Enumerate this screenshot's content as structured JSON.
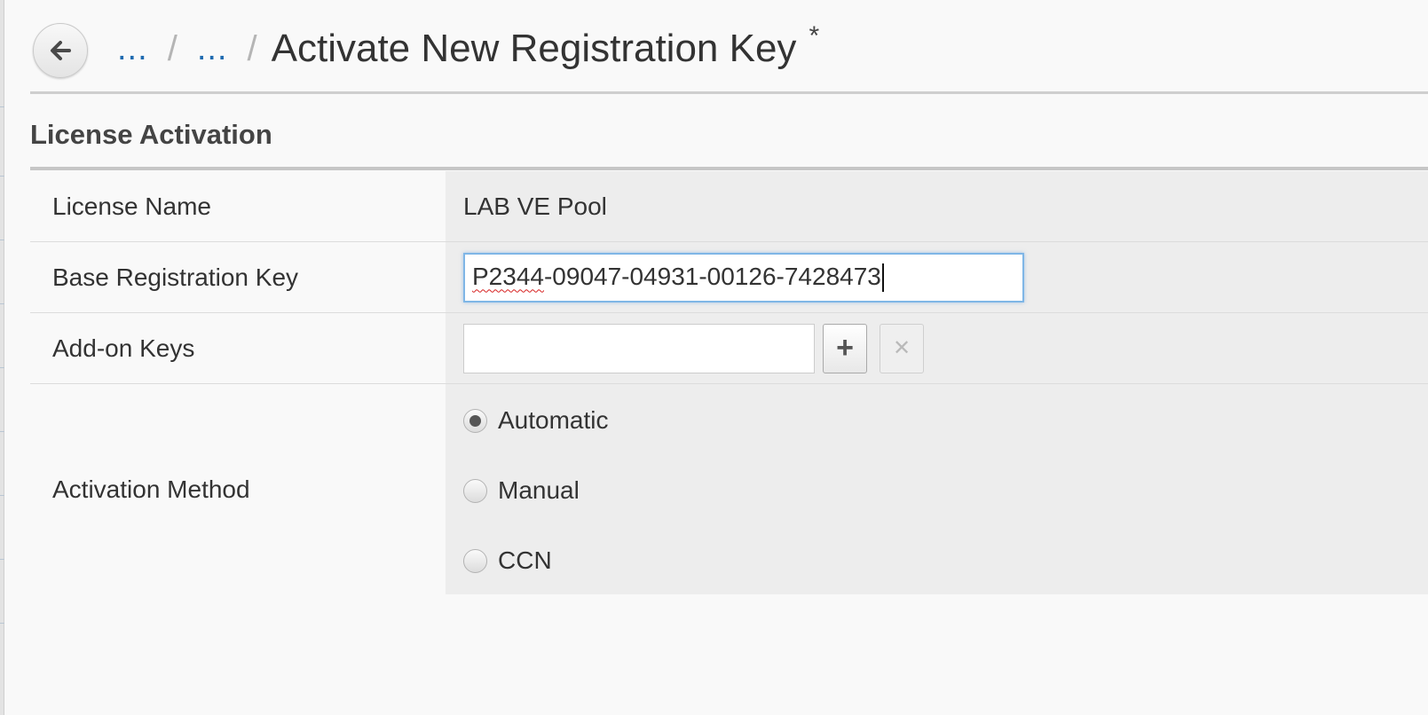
{
  "header": {
    "breadcrumb": [
      {
        "label": "..."
      },
      {
        "label": "..."
      }
    ],
    "separator": "/",
    "title": "Activate New Registration Key",
    "unsaved_indicator": "*",
    "back_icon": "arrow-left-icon"
  },
  "section": {
    "title": "License Activation"
  },
  "form": {
    "license_name": {
      "label": "License Name",
      "value": "LAB VE Pool"
    },
    "base_registration_key": {
      "label": "Base Registration Key",
      "value_prefix": "P2344",
      "value_rest": "-09047-04931-00126-7428473"
    },
    "addon_keys": {
      "label": "Add-on Keys",
      "value": "",
      "add_symbol": "+",
      "remove_symbol": "✕"
    },
    "activation_method": {
      "label": "Activation Method",
      "selected": "Automatic",
      "options": [
        {
          "label": "Automatic"
        },
        {
          "label": "Manual"
        },
        {
          "label": "CCN"
        }
      ]
    }
  },
  "colors": {
    "link": "#1f6bb0",
    "value_bg": "#ededed",
    "focus_border": "#7fb6e6"
  }
}
